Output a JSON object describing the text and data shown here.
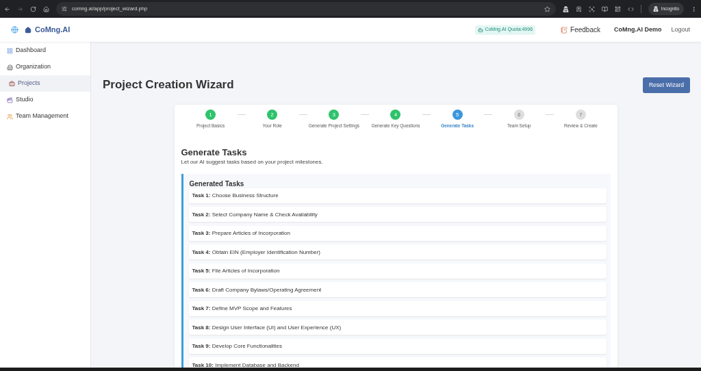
{
  "browser": {
    "url": "comng.ai/app/project_wizard.php",
    "profile": "Incognito"
  },
  "header": {
    "brand": "CoMng.AI",
    "quota": "CoMng.AI Quota:4996",
    "nav": [
      {
        "kind": "icon_link",
        "label": "Feedback"
      },
      {
        "kind": "account",
        "label": "CoMng.AI Demo"
      },
      {
        "kind": "link",
        "label": "Logout"
      }
    ]
  },
  "sidebar": {
    "items": [
      {
        "label": "Dashboard",
        "selected": false
      },
      {
        "label": "Organization",
        "selected": false
      },
      {
        "label": "Projects",
        "selected": true
      },
      {
        "label": "Studio",
        "selected": false
      },
      {
        "label": "Team Management",
        "selected": false
      }
    ]
  },
  "page": {
    "title": "Project Creation Wizard",
    "reset_button": "Reset Wizard"
  },
  "stepper": {
    "steps": [
      {
        "number": "1",
        "label": "Project Basics",
        "kind": "done"
      },
      {
        "number": "2",
        "label": "Your Role",
        "kind": "done"
      },
      {
        "number": "3",
        "label": "Generate Project Settings",
        "kind": "done"
      },
      {
        "number": "4",
        "label": "Generate Key Questions",
        "kind": "done"
      },
      {
        "number": "5",
        "label": "Generate Tasks",
        "kind": "current"
      },
      {
        "number": "6",
        "label": "Team Setup",
        "kind": "upcoming"
      },
      {
        "number": "7",
        "label": "Review & Create",
        "kind": "upcoming"
      }
    ]
  },
  "section": {
    "title": "Generate Tasks",
    "subtitle": "Let our AI suggest tasks based on your project milestones."
  },
  "tasks": {
    "title": "Generated Tasks",
    "items": [
      "**Task 1:** Choose Business Structure",
      "**Task 2:** Select Company Name & Check Availability",
      "**Task 3:** Prepare Articles of Incorporation",
      "**Task 4:** Obtain EIN (Employer Identification Number)",
      "**Task 5:** File Articles of Incorporation",
      "**Task 6:** Draft Company Bylaws/Operating Agreement",
      "**Task 7:** Define MVP Scope and Features",
      "**Task 8:** Design User Interface (UI) and User Experience (UX)",
      "**Task 9:** Develop Core Functionalities",
      "**Task 10:** Implement Database and Backend"
    ]
  }
}
